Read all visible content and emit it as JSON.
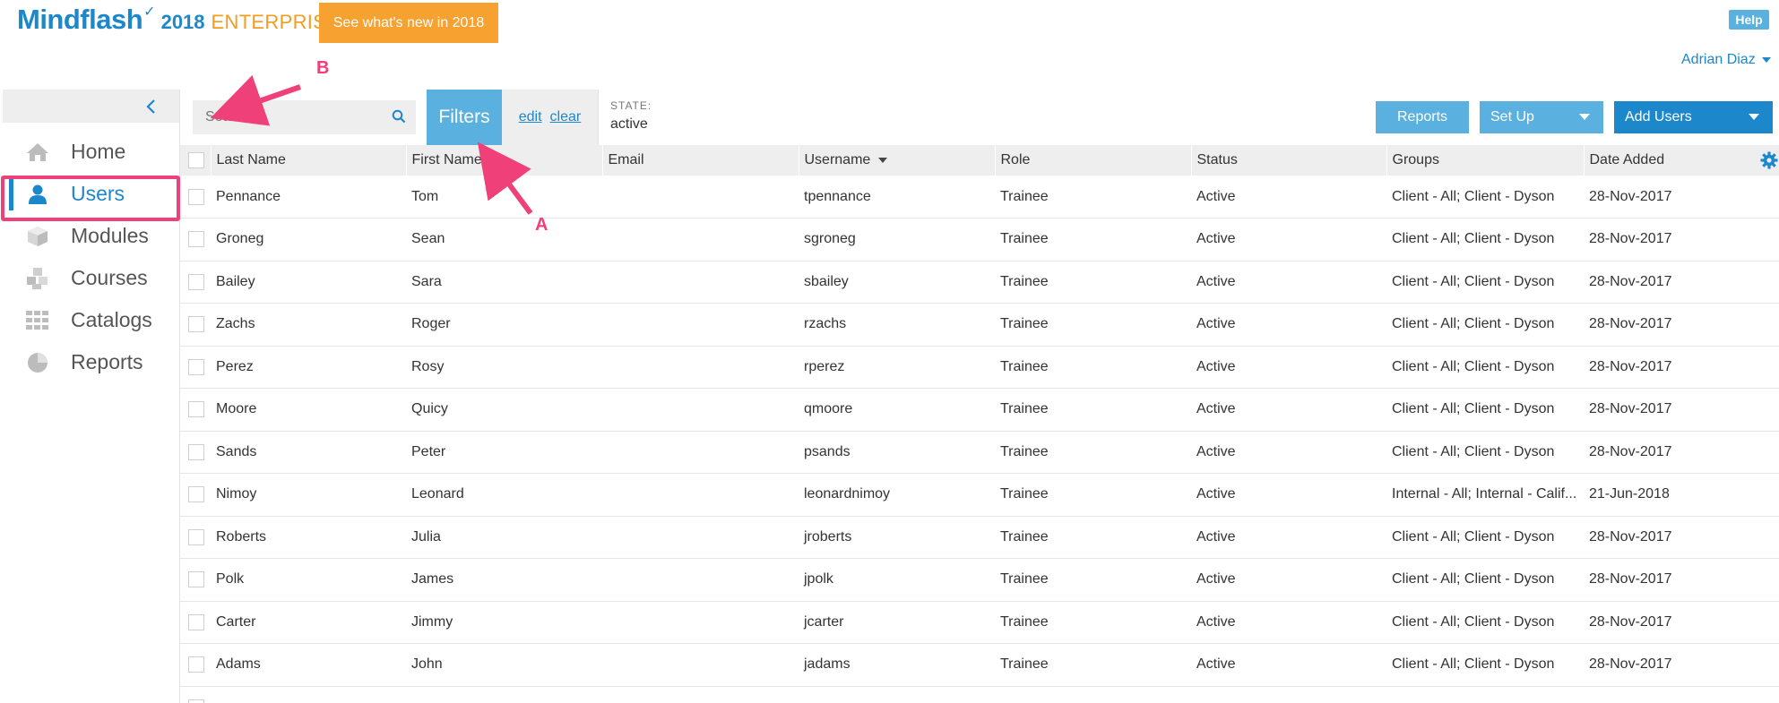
{
  "header": {
    "logo_brand": "Mindflash",
    "logo_year": "2018",
    "logo_edition": "ENTERPRISE",
    "whats_new": "See what's new in 2018",
    "help": "Help",
    "user_name": "Adrian Diaz"
  },
  "sidebar": {
    "items": [
      {
        "label": "Home",
        "icon": "home-icon",
        "active": false
      },
      {
        "label": "Users",
        "icon": "user-icon",
        "active": true
      },
      {
        "label": "Modules",
        "icon": "cube-icon",
        "active": false
      },
      {
        "label": "Courses",
        "icon": "cubes-icon",
        "active": false
      },
      {
        "label": "Catalogs",
        "icon": "grid-icon",
        "active": false
      },
      {
        "label": "Reports",
        "icon": "pie-chart-icon",
        "active": false
      }
    ]
  },
  "toolbar": {
    "search_placeholder": "Search...",
    "filters": "Filters",
    "edit": "edit",
    "clear": "clear",
    "state_label": "STATE:",
    "state_value": "active",
    "reports": "Reports",
    "setup": "Set Up",
    "add_users": "Add Users"
  },
  "table": {
    "columns": [
      "Last Name",
      "First Name",
      "Email",
      "Username",
      "Role",
      "Status",
      "Groups",
      "Date Added"
    ],
    "rows": [
      [
        "Pennance",
        "Tom",
        "",
        "tpennance",
        "Trainee",
        "Active",
        "Client - All; Client - Dyson",
        "28-Nov-2017"
      ],
      [
        "Groneg",
        "Sean",
        "",
        "sgroneg",
        "Trainee",
        "Active",
        "Client - All; Client - Dyson",
        "28-Nov-2017"
      ],
      [
        "Bailey",
        "Sara",
        "",
        "sbailey",
        "Trainee",
        "Active",
        "Client - All; Client - Dyson",
        "28-Nov-2017"
      ],
      [
        "Zachs",
        "Roger",
        "",
        "rzachs",
        "Trainee",
        "Active",
        "Client - All; Client - Dyson",
        "28-Nov-2017"
      ],
      [
        "Perez",
        "Rosy",
        "",
        "rperez",
        "Trainee",
        "Active",
        "Client - All; Client - Dyson",
        "28-Nov-2017"
      ],
      [
        "Moore",
        "Quicy",
        "",
        "qmoore",
        "Trainee",
        "Active",
        "Client - All; Client - Dyson",
        "28-Nov-2017"
      ],
      [
        "Sands",
        "Peter",
        "",
        "psands",
        "Trainee",
        "Active",
        "Client - All; Client - Dyson",
        "28-Nov-2017"
      ],
      [
        "Nimoy",
        "Leonard",
        "",
        "leonardnimoy",
        "Trainee",
        "Active",
        "Internal - All; Internal - Calif...",
        "21-Jun-2018"
      ],
      [
        "Roberts",
        "Julia",
        "",
        "jroberts",
        "Trainee",
        "Active",
        "Client - All; Client - Dyson",
        "28-Nov-2017"
      ],
      [
        "Polk",
        "James",
        "",
        "jpolk",
        "Trainee",
        "Active",
        "Client - All; Client - Dyson",
        "28-Nov-2017"
      ],
      [
        "Carter",
        "Jimmy",
        "",
        "jcarter",
        "Trainee",
        "Active",
        "Client - All; Client - Dyson",
        "28-Nov-2017"
      ],
      [
        "Adams",
        "John",
        "",
        "jadams",
        "Trainee",
        "Active",
        "Client - All; Client - Dyson",
        "28-Nov-2017"
      ],
      [
        "",
        "",
        "",
        "",
        "",
        "",
        "",
        ""
      ]
    ]
  },
  "annotations": {
    "a": "A",
    "b": "B"
  },
  "colors": {
    "brand_blue": "#1d87cc",
    "light_blue": "#5ab1df",
    "orange": "#f7a131",
    "annotation_pink": "#f0407a"
  }
}
